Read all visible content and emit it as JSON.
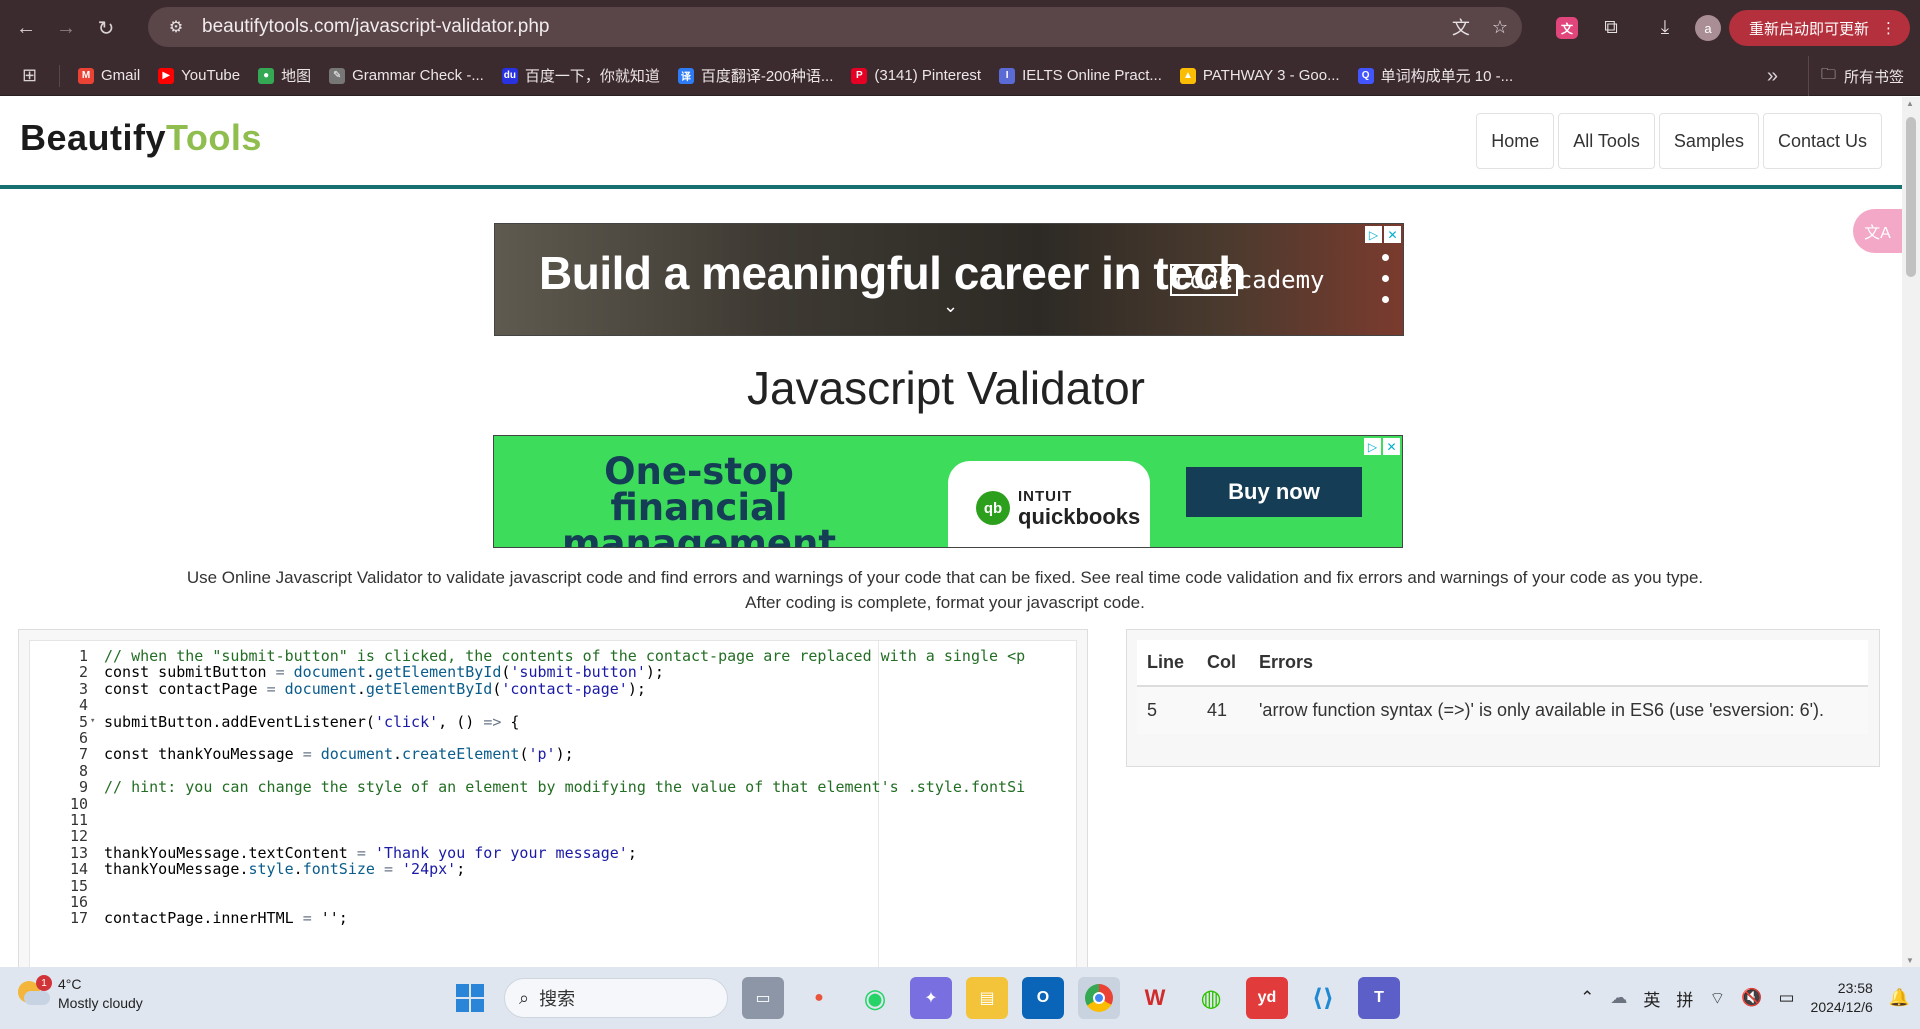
{
  "browser": {
    "url": "beautifytools.com/javascript-validator.php",
    "update_label": "重新启动即可更新",
    "profile_initial": "a",
    "all_bookmarks_label": "所有书签",
    "bookmarks": [
      {
        "label": "Gmail",
        "icon": "gmail-icon",
        "color": "#ea4335",
        "glyph": "M"
      },
      {
        "label": "YouTube",
        "icon": "youtube-icon",
        "color": "#ff0000",
        "glyph": "▶"
      },
      {
        "label": "地图",
        "icon": "maps-icon",
        "color": "#34a853",
        "glyph": "●"
      },
      {
        "label": "Grammar Check -...",
        "icon": "grammar-icon",
        "color": "#777777",
        "glyph": "✎"
      },
      {
        "label": "百度一下，你就知道",
        "icon": "baidu-icon",
        "color": "#2932e1",
        "glyph": "du"
      },
      {
        "label": "百度翻译-200种语...",
        "icon": "baidu-translate-icon",
        "color": "#2e7bf6",
        "glyph": "译"
      },
      {
        "label": "(3141) Pinterest",
        "icon": "pinterest-icon",
        "color": "#e60023",
        "glyph": "P"
      },
      {
        "label": "IELTS Online Pract...",
        "icon": "ielts-icon",
        "color": "#5b6bd6",
        "glyph": "I"
      },
      {
        "label": "PATHWAY 3 - Goo...",
        "icon": "google-drive-icon",
        "color": "#fbbc04",
        "glyph": "▲"
      },
      {
        "label": "单词构成单元 10 -...",
        "icon": "quizlet-icon",
        "color": "#4255ff",
        "glyph": "Q"
      }
    ]
  },
  "site": {
    "logo_part1": "Beautify",
    "logo_part2": "Tools",
    "nav": [
      "Home",
      "All Tools",
      "Samples",
      "Contact Us"
    ]
  },
  "ads": {
    "top_headline": "Build a meaningful career in tech",
    "top_brand_box": "code",
    "top_brand_rest": "cademy",
    "middle_headline": "One-stop financial management",
    "middle_brand_top": "INTUIT",
    "middle_brand_bottom": "quickbooks",
    "middle_cta": "Buy now"
  },
  "page": {
    "title": "Javascript Validator",
    "description": "Use Online Javascript Validator to validate javascript code and find errors and warnings of your code that can be fixed. See real time code validation and fix errors and warnings of your code as you type. After coding is complete, format your javascript code."
  },
  "editor": {
    "lines": [
      {
        "n": "1",
        "fold": false,
        "html": "<span class='cm'>// when the \"submit-button\" is clicked, the contents of the contact-page are replaced with a single &lt;p</span>"
      },
      {
        "n": "2",
        "fold": false,
        "html": "const submitButton <span class='op'>=</span> <span class='prop'>document</span>.<span class='prop'>getElementById</span>(<span class='str'>'submit-button'</span>);"
      },
      {
        "n": "3",
        "fold": false,
        "html": "const contactPage <span class='op'>=</span> <span class='prop'>document</span>.<span class='prop'>getElementById</span>(<span class='str'>'contact-page'</span>);"
      },
      {
        "n": "4",
        "fold": false,
        "html": ""
      },
      {
        "n": "5",
        "fold": true,
        "html": "submitButton.addEventListener(<span class='str'>'click'</span>, () <span class='op'>=&gt;</span> {"
      },
      {
        "n": "6",
        "fold": false,
        "html": ""
      },
      {
        "n": "7",
        "fold": false,
        "html": "const thankYouMessage <span class='op'>=</span> <span class='prop'>document</span>.<span class='prop'>createElement</span>(<span class='str'>'p'</span>);"
      },
      {
        "n": "8",
        "fold": false,
        "html": ""
      },
      {
        "n": "9",
        "fold": false,
        "html": "<span class='cm'>// hint: you can change the style of an element by modifying the value of that element's .style.fontSi</span>"
      },
      {
        "n": "10",
        "fold": false,
        "html": ""
      },
      {
        "n": "11",
        "fold": false,
        "html": ""
      },
      {
        "n": "12",
        "fold": false,
        "html": ""
      },
      {
        "n": "13",
        "fold": false,
        "html": "thankYouMessage.textContent <span class='op'>=</span> <span class='str'>'Thank you for your message'</span>;"
      },
      {
        "n": "14",
        "fold": false,
        "html": "thankYouMessage.<span class='prop'>style</span>.<span class='prop'>fontSize</span> <span class='op'>=</span> <span class='str'>'24px'</span>;"
      },
      {
        "n": "15",
        "fold": false,
        "html": ""
      },
      {
        "n": "16",
        "fold": false,
        "html": ""
      },
      {
        "n": "17",
        "fold": false,
        "html": "contactPage.innerHTML <span class='op'>=</span> '';"
      }
    ]
  },
  "results": {
    "headers": [
      "Line",
      "Col",
      "Errors"
    ],
    "rows": [
      {
        "line": "5",
        "col": "41",
        "error": "'arrow function syntax (=>)' is only available in ES6 (use 'esversion: 6')."
      }
    ]
  },
  "taskbar": {
    "temperature": "4°C",
    "weather": "Mostly cloudy",
    "weather_badge": "1",
    "search_placeholder": "搜索",
    "ime_lang": "英",
    "ime_mode": "拼",
    "time": "23:58",
    "date": "2024/12/6"
  }
}
